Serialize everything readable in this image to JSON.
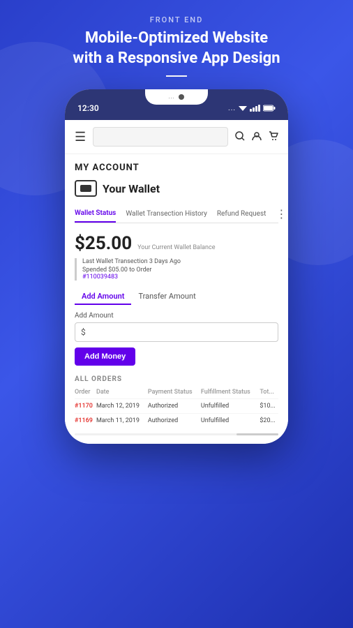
{
  "page": {
    "label": "FRONT END",
    "title": "Mobile-Optimized Website with a Responsive App Design"
  },
  "phone": {
    "status_time": "12:30",
    "status_dots": "...",
    "notch_dots": "...",
    "header": {
      "hamburger": "☰",
      "search_placeholder": "",
      "icons": {
        "search": "🔍",
        "user": "👤",
        "cart": "🛒"
      }
    }
  },
  "account": {
    "section_label": "MY ACCOUNT",
    "wallet_title": "Your Wallet",
    "tabs": [
      {
        "label": "Wallet Status",
        "active": true
      },
      {
        "label": "Wallet Transection History",
        "active": false
      },
      {
        "label": "Refund Request",
        "active": false
      }
    ],
    "balance": {
      "amount": "$25.00",
      "label": "Your Current Wallet Balance"
    },
    "last_transaction": {
      "title": "Last Wallet Transection 3 Days Ago",
      "detail": "Spended $05.00 to Order",
      "order_link": "#110039483"
    },
    "action_tabs": [
      {
        "label": "Add Amount",
        "active": true
      },
      {
        "label": "Transfer Amount",
        "active": false
      }
    ],
    "add_amount": {
      "label": "Add Amount",
      "dollar_sign": "$",
      "btn_label": "Add Money"
    },
    "orders": {
      "section_label": "ALL ORDERS",
      "columns": [
        "Order",
        "Date",
        "Payment Status",
        "Fulfillment Status",
        "Tot..."
      ],
      "rows": [
        {
          "order": "#1170",
          "date": "March 12, 2019",
          "payment_status": "Authorized",
          "fulfillment_status": "Unfulfilled",
          "total": "$10..."
        },
        {
          "order": "#1169",
          "date": "March 11, 2019",
          "payment_status": "Authorized",
          "fulfillment_status": "Unfulfilled",
          "total": "$20..."
        }
      ]
    }
  },
  "colors": {
    "accent": "#6200ea",
    "order_link": "#e53935",
    "background": "#2a3fca"
  }
}
